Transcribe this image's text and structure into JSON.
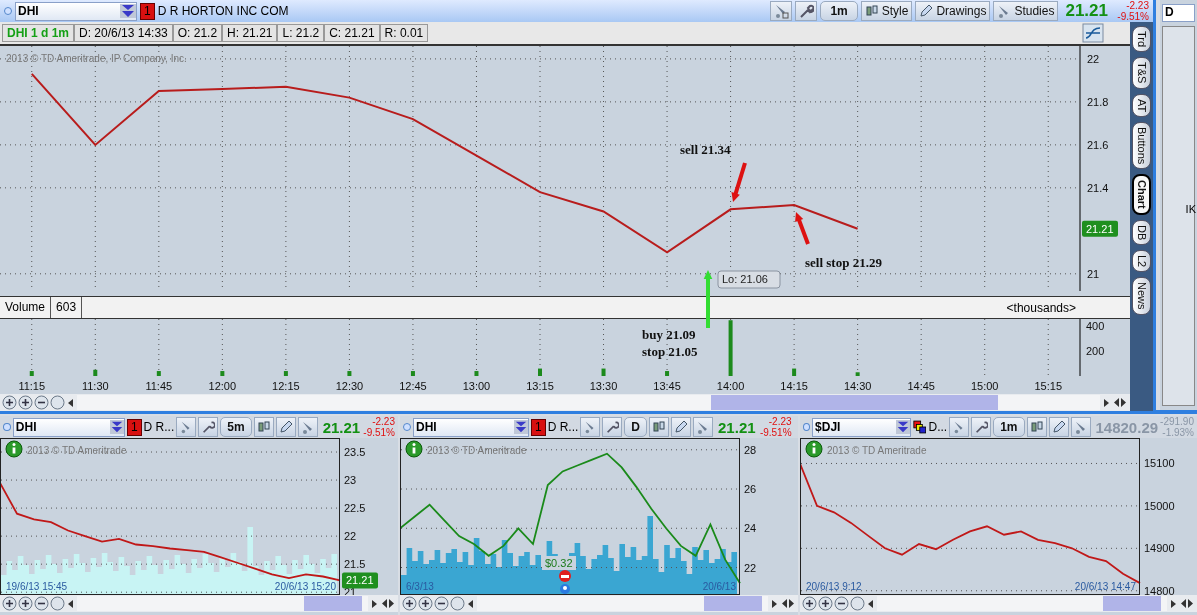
{
  "main_window": {
    "symbol": "DHI",
    "badge": "1",
    "company": "D R HORTON INC COM",
    "timeframe": "1m",
    "buttons": [
      "Style",
      "Drawings",
      "Studies"
    ],
    "price": "21.21",
    "change": "-2.23",
    "change_pct": "-9.51%",
    "info_bar": [
      "DHI 1 d 1m",
      "D: 20/6/13 14:33",
      "O: 21.2",
      "H: 21.21",
      "L: 21.2",
      "C: 21.21",
      "R: 0.01"
    ],
    "copyright": "2013 © TD Ameritrade, IP Company, Inc.",
    "last_price": "21.21",
    "chart_data": {
      "type": "line",
      "series": [
        {
          "color": "#b81c1c",
          "values": [
            21.93,
            21.6,
            21.85,
            21.86,
            21.87,
            21.82,
            21.72,
            21.55,
            21.38,
            21.29,
            21.1,
            21.3,
            21.32,
            21.21,
            null,
            null,
            null
          ]
        }
      ],
      "ylim": [
        20.92,
        22.06
      ],
      "yticks": [
        21,
        21.4,
        21.6,
        21.8,
        22
      ],
      "grid": true,
      "annotations": [
        "sell 21.34",
        "sell stop 21.29",
        "buy 21.09",
        "stop 21.05",
        "Lo: 21.06"
      ]
    },
    "arrows": [
      {
        "color": "#dd1111"
      },
      {
        "color": "#dd1111"
      },
      {
        "color": "#33dd33"
      }
    ]
  },
  "volume": {
    "label": "Volume",
    "reading": "603",
    "unit": "<thousands>",
    "chart_data": {
      "type": "bar",
      "categories": [
        "11:15",
        "11:30",
        "11:45",
        "12:00",
        "12:15",
        "12:30",
        "12:45",
        "13:00",
        "13:15",
        "13:30",
        "13:45",
        "14:00",
        "14:15",
        "14:30",
        "14:45",
        "15:00",
        "15:15"
      ],
      "series": [
        {
          "color": "#1c8a1c",
          "values": [
            40,
            50,
            40,
            40,
            40,
            40,
            40,
            40,
            60,
            60,
            40,
            450,
            60,
            30,
            null,
            null,
            null
          ]
        }
      ],
      "ylim": [
        0,
        460
      ],
      "yticks": [
        200,
        400
      ],
      "grid": true
    }
  },
  "side_tabs": [
    {
      "label": "Trd",
      "selected": false
    },
    {
      "label": "T&S",
      "selected": false
    },
    {
      "label": "AT",
      "selected": false
    },
    {
      "label": "Buttons",
      "selected": false
    },
    {
      "label": "Chart",
      "selected": true
    },
    {
      "label": "DB",
      "selected": false
    },
    {
      "label": "L2",
      "selected": false
    },
    {
      "label": "News",
      "selected": false
    }
  ],
  "side_window": {
    "symbol": "D",
    "edge_text": "IK"
  },
  "panels": [
    {
      "symbol": "DHI",
      "kind": "stock",
      "badge": "1",
      "name": "D R...",
      "timeframe": "5m",
      "price": "21.21",
      "stale": false,
      "change": "-2.23",
      "change_pct": "-9.51%",
      "copyright": "2013 © TD Ameritrade",
      "last_price": "21.21",
      "volume": {
        "color": "#c8f4f4"
      },
      "start_date": "19/6/13 15:45",
      "end_date": "20/6/13 15:20",
      "chart_data": {
        "type": "line",
        "series": [
          {
            "color": "#c01818",
            "values": [
              22.95,
              22.4,
              22.3,
              22.25,
              22.1,
              22.0,
              21.9,
              21.95,
              21.85,
              21.82,
              21.78,
              21.75,
              21.72,
              21.62,
              21.52,
              21.42,
              21.32,
              21.25,
              21.32,
              21.28,
              21.21
            ]
          }
        ],
        "ylim": [
          20.95,
          23.75
        ],
        "yticks": [
          21,
          21.5,
          22,
          22.5,
          23,
          23.5
        ],
        "grid": true
      }
    },
    {
      "symbol": "DHI",
      "kind": "stock",
      "badge": "1",
      "name": "D R...",
      "timeframe": "D",
      "price": "21.21",
      "stale": false,
      "change": "-2.23",
      "change_pct": "-9.51%",
      "copyright": "2013 © TD Ameritrade",
      "volume": {
        "color": "#3aa6d2"
      },
      "start_date": "6/3/13",
      "end_date": "20/6/13",
      "note": "$0.32",
      "chart_data": {
        "type": "line",
        "series": [
          {
            "color": "#1a8a1a",
            "values": [
              24,
              24.6,
              25.2,
              24.4,
              23.6,
              23.2,
              22.6,
              23.1,
              24,
              23.2,
              26.2,
              26.9,
              27.2,
              27.5,
              27.8,
              27.1,
              26.1,
              25,
              24,
              23.1,
              22.6,
              24.2,
              22.4,
              21.2
            ]
          }
        ],
        "ylim": [
          20.6,
          28.6
        ],
        "yticks": [
          22,
          24,
          26,
          28
        ],
        "grid": true
      }
    },
    {
      "symbol": "$DJI",
      "kind": "index",
      "name": "D...",
      "timeframe": "1m",
      "price": "14820.29",
      "stale": true,
      "change": "-291.90",
      "change_pct": "-1.93%",
      "copyright": "2013 © TD Ameritrade",
      "start_date": "20/6/13 9:12",
      "end_date": "20/6/13 14:47",
      "chart_data": {
        "type": "line",
        "series": [
          {
            "color": "#c01818",
            "values": [
              15100,
              15000,
              14985,
              14960,
              14930,
              14900,
              14885,
              14910,
              14898,
              14920,
              14940,
              14952,
              14932,
              14940,
              14920,
              14912,
              14900,
              14880,
              14870,
              14840,
              14818
            ]
          }
        ],
        "ylim": [
          14790,
          15160
        ],
        "yticks": [
          14800,
          14900,
          15000,
          15100
        ],
        "grid": true
      }
    }
  ]
}
